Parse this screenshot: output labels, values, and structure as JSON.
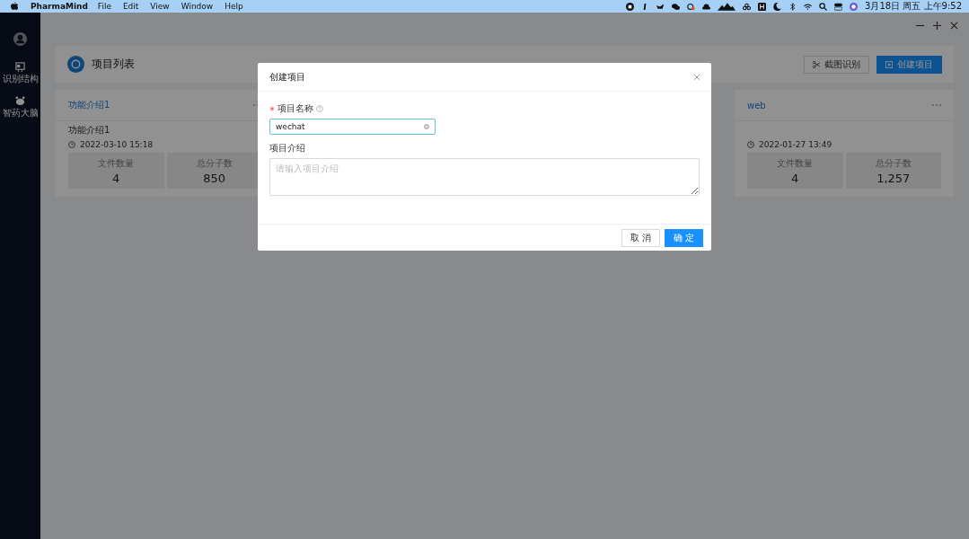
{
  "menu_bar": {
    "app_name": "PharmaMind",
    "menus": [
      "File",
      "Edit",
      "View",
      "Window",
      "Help"
    ],
    "clock": "3月18日 周五 上午9:52"
  },
  "sidebar": {
    "items": [
      {
        "label": "识别结构",
        "kind": "structure"
      },
      {
        "label": "智药大脑",
        "kind": "brain"
      }
    ]
  },
  "header": {
    "title": "项目列表",
    "buttons": [
      {
        "label": "截图识别",
        "kind": "screenshot"
      },
      {
        "label": "创建项目",
        "kind": "create"
      }
    ]
  },
  "projects": [
    {
      "title": "功能介绍1",
      "description": "功能介绍1",
      "date": "2022-03-10 15:18",
      "stats": [
        {
          "label": "文件数量",
          "value": "4"
        },
        {
          "label": "总分子数",
          "value": "850"
        }
      ]
    },
    {
      "title": "web",
      "date": "2022-01-27 13:49",
      "stats": [
        {
          "label": "文件数量",
          "value": "4"
        },
        {
          "label": "总分子数",
          "value": "1,257"
        }
      ]
    }
  ],
  "dialog": {
    "title": "创建项目",
    "fields": [
      {
        "label": "项目名称",
        "required": true,
        "help": true,
        "kind": "input",
        "value": "wechat"
      },
      {
        "label": "项目介绍",
        "required": false,
        "help": false,
        "kind": "textarea",
        "placeholder": "请输入项目介绍"
      }
    ],
    "buttons": [
      {
        "label": "取 消",
        "primary": false
      },
      {
        "label": "确 定",
        "primary": true
      }
    ]
  }
}
